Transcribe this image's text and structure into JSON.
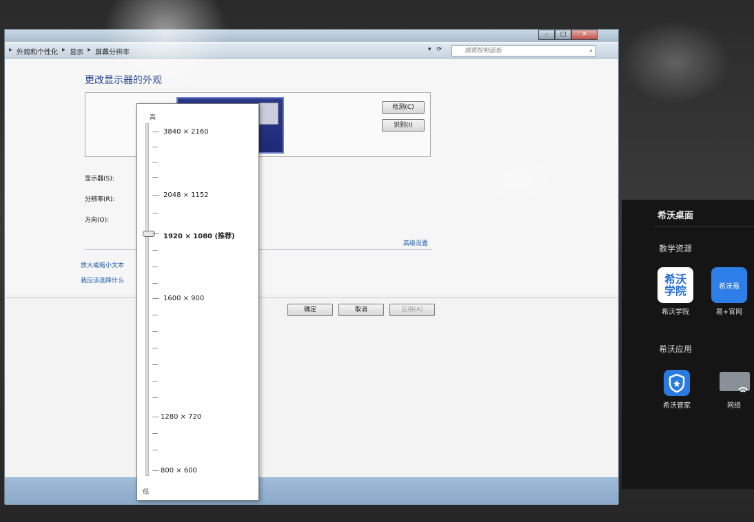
{
  "window": {
    "breadcrumb": [
      "外观和个性化",
      "显示",
      "屏幕分辨率"
    ],
    "search_placeholder": "搜索控制面板",
    "title": "更改显示器的外观",
    "buttons": {
      "detect": "检测(C)",
      "identify": "识别(I)",
      "ok": "确定",
      "cancel": "取消",
      "apply": "应用(A)"
    },
    "labels": {
      "display": "显示器(S):",
      "resolution": "分辨率(R):",
      "orientation": "方向(O):"
    },
    "advanced_link": "高级设置",
    "links": [
      "放大或缩小文本",
      "我应该选择什么"
    ]
  },
  "resolution_slider": {
    "high_label": "高",
    "low_label": "低",
    "selected": "1920 × 1080 (推荐)",
    "options": [
      "3840 × 2160",
      "2048 × 1152",
      "1920 × 1080 (推荐)",
      "1600 × 900",
      "1280 × 720",
      "800 × 600"
    ]
  },
  "launcher": {
    "title": "希沃桌面",
    "section1": "教学资源",
    "apps1": [
      {
        "label": "希沃学院",
        "tile_text": "希沃学院",
        "color": "#2a6fd6"
      },
      {
        "label": "易+官网",
        "tile_text": "希沃易",
        "color": "#2d7ee8"
      }
    ],
    "section2": "希沃应用",
    "apps2": [
      {
        "label": "希沃管家",
        "color": "#2a7be0"
      },
      {
        "label": "网络",
        "color": "#7a7f86"
      }
    ]
  }
}
